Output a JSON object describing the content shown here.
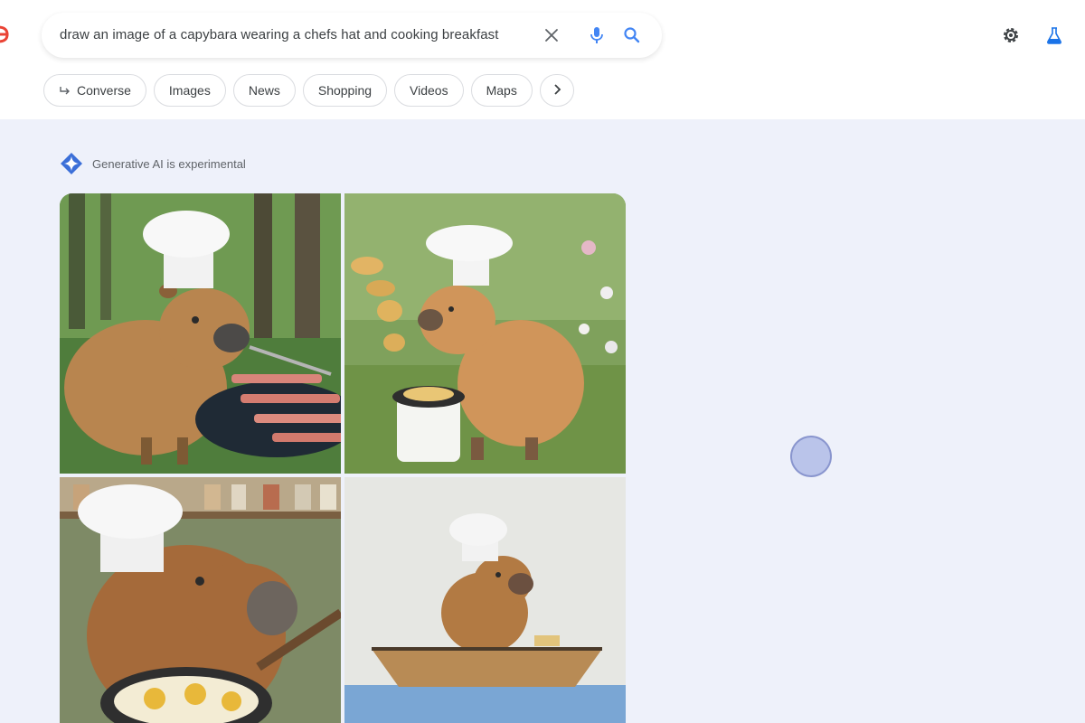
{
  "search": {
    "query": "draw an image of a capybara wearing a chefs hat and cooking breakfast"
  },
  "icons": {
    "clear": "close-icon",
    "mic": "mic-icon",
    "search": "search-icon",
    "settings": "gear-icon",
    "labs": "flask-icon",
    "sparkle": "sparkle-icon",
    "converse": "arrow-icon",
    "more": "chevron-right-icon"
  },
  "tabs": [
    {
      "label": "Converse"
    },
    {
      "label": "Images"
    },
    {
      "label": "News"
    },
    {
      "label": "Shopping"
    },
    {
      "label": "Videos"
    },
    {
      "label": "Maps"
    }
  ],
  "ai": {
    "label": "Generative AI is experimental"
  },
  "colors": {
    "background": "#eef1fa",
    "accent_blue": "#4285f4",
    "labs_blue": "#1a73e8"
  }
}
